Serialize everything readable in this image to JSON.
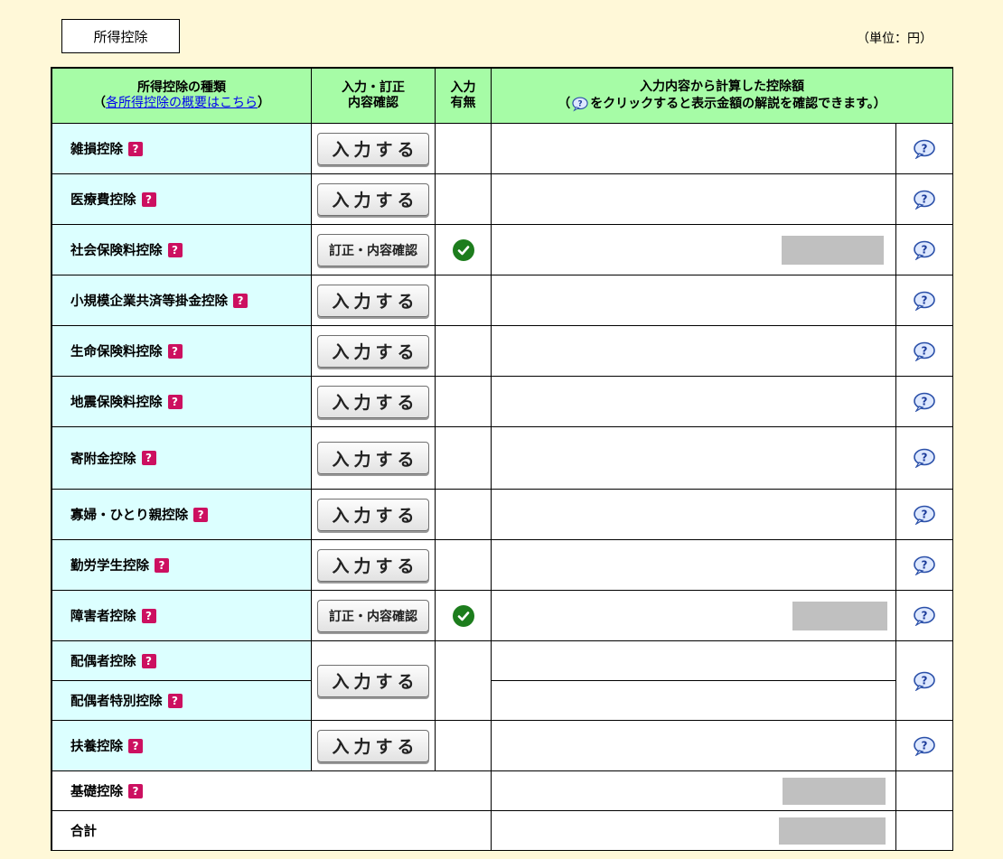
{
  "section_tab": "所得控除",
  "unit": "（単位：円）",
  "headers": {
    "type_title": "所得控除の種類",
    "type_link_open": "（",
    "type_link": "各所得控除の概要はこちら",
    "type_link_close": "）",
    "input_line1": "入力・訂正",
    "input_line2": "内容確認",
    "status_line1": "入力",
    "status_line2": "有無",
    "amount_line1": "入力内容から計算した控除額",
    "amount_open": "（",
    "amount_line2": "をクリックすると表示金額の解説を確認できます。）"
  },
  "buttons": {
    "input": "入力する",
    "correct": "訂正・内容確認"
  },
  "qmark_glyph": "?",
  "rows": [
    {
      "label": "雑損控除",
      "has_input": false
    },
    {
      "label": "医療費控除",
      "has_input": false
    },
    {
      "label": "社会保険料控除",
      "has_input": true,
      "amount": "",
      "amount_masked": true
    },
    {
      "label": "小規模企業共済等掛金控除",
      "has_input": false
    },
    {
      "label": "生命保険料控除",
      "has_input": false
    },
    {
      "label": "地震保険料控除",
      "has_input": false
    },
    {
      "label": "寄附金控除",
      "has_input": false
    },
    {
      "label": "寡婦・ひとり親控除",
      "has_input": false
    },
    {
      "label": "勤労学生控除",
      "has_input": false
    },
    {
      "label": "障害者控除",
      "has_input": true,
      "amount": "",
      "amount_masked": true
    },
    {
      "label": "配偶者控除",
      "has_input": false
    },
    {
      "label": "配偶者特別控除",
      "has_input": false
    },
    {
      "label": "扶養控除",
      "has_input": false
    },
    {
      "label": "基礎控除",
      "amount": "",
      "amount_masked": true
    },
    {
      "label": "合計",
      "amount": "",
      "amount_masked": true
    }
  ],
  "colors": {
    "background": "#fff8d8",
    "header": "#a6fca6",
    "name_cell": "#dcffff",
    "qmark": "#cc1060",
    "check": "#1d7d1d",
    "masked": "#c0c0c0"
  },
  "icons": {
    "help": "help-bubble-icon",
    "qmark": "question-mark-icon",
    "check": "check-circle-icon"
  }
}
